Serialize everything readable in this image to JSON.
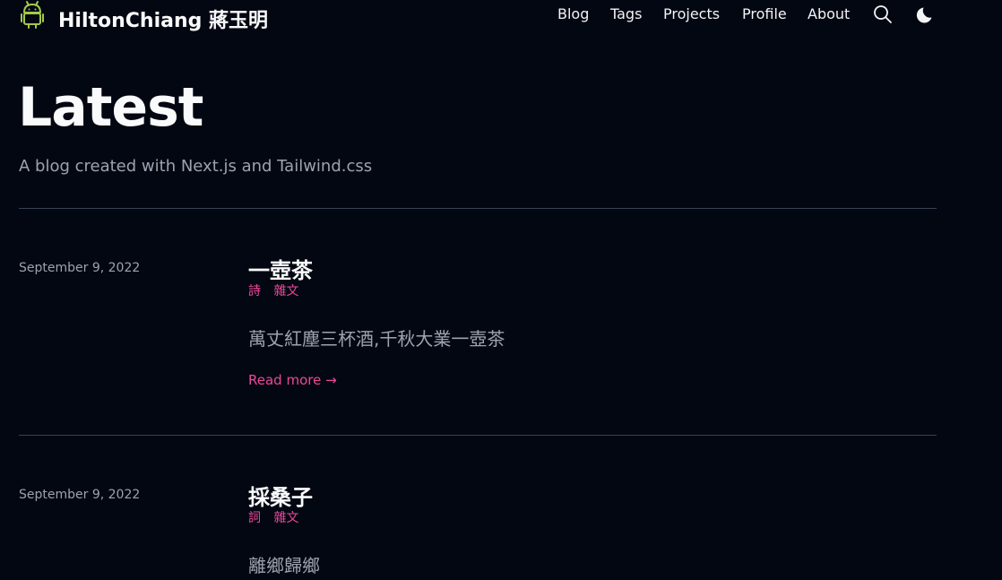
{
  "header": {
    "site_title": "HiltonChiang 蔣玉明",
    "logo_icon": "android-icon",
    "nav": [
      "Blog",
      "Tags",
      "Projects",
      "Profile",
      "About"
    ],
    "search_icon": "search-icon",
    "theme_icon": "moon-icon"
  },
  "hero": {
    "title": "Latest",
    "subtitle": "A blog created with Next.js and Tailwind.css"
  },
  "posts": [
    {
      "date": "September 9, 2022",
      "title": "一壺茶",
      "tags": [
        "詩",
        "雜文"
      ],
      "summary": "萬丈紅塵三杯酒,千秋大業一壺茶",
      "read_more": "Read more →"
    },
    {
      "date": "September 9, 2022",
      "title": "採桑子",
      "tags": [
        "詞",
        "雜文"
      ],
      "summary": "離鄉歸鄉"
    }
  ],
  "colors": {
    "background": "#030712",
    "accent": "#ec4899",
    "logo": "#a3c94a",
    "muted": "#9ca3af",
    "divider": "#374151"
  }
}
